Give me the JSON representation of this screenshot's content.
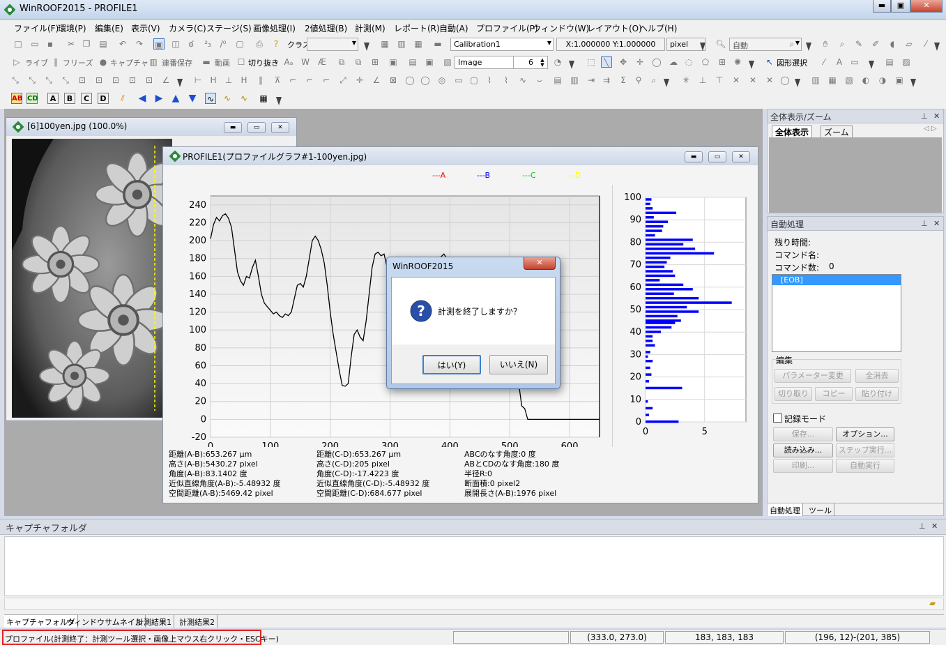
{
  "app": {
    "title": "WinROOF2015 - PROFILE1",
    "brand_color": "#2a8a3a"
  },
  "menu": [
    "ファイル(F)",
    "環境(P)",
    "編集(E)",
    "表示(V)",
    "カメラ(C)",
    "ステージ(S)",
    "画像処理(I)",
    "2値処理(B)",
    "計測(M)",
    "レポート(R)",
    "自動(A)",
    "プロファイル(P)",
    "ウィンドウ(W)",
    "レイアウト(O)",
    "ヘルプ(H)"
  ],
  "toolbar": {
    "class_label": "クラス",
    "calibration": "Calibration1",
    "scale": "X:1.000000  Y:1.000000",
    "unit": "pixel",
    "auto": "自動",
    "live": "ライブ",
    "freeze": "フリーズ",
    "capture": "キャプチャ",
    "seq_save": "連番保存",
    "video": "動画",
    "crop": "切り抜き",
    "image_combo": "Image",
    "spin_value": "6",
    "shape_select": "図形選択"
  },
  "image_window": {
    "title": "[6]100yen.jpg (100.0%)"
  },
  "profile_window": {
    "title": "PROFILE1(プロファイルグラフ#1-100yen.jpg)",
    "legend": [
      {
        "label": "---A",
        "color": "#ff0000"
      },
      {
        "label": "---B",
        "color": "#0000ff"
      },
      {
        "label": "---C",
        "color": "#00cc00"
      },
      {
        "label": "---D",
        "color": "#ffff00"
      }
    ],
    "info": [
      [
        "距離(A-B):653.267 μm",
        "高さ(A-B):5430.27 pixel",
        "角度(A-B):83.1402 度",
        "近似直線角度(A-B):-5.48932 度",
        "空間距離(A-B):5469.42 pixel"
      ],
      [
        "距離(C-D):653.267 μm",
        "高さ(C-D):205 pixel",
        "角度(C-D):-17.4223 度",
        "近似直線角度(C-D):-5.48932 度",
        "空間距離(C-D):684.677 pixel"
      ],
      [
        "ABCのなす角度:0 度",
        "ABとCDのなす角度:180 度",
        "半径R:0",
        "断面積:0 pixel2",
        "展開長さ(A-B):1976 pixel"
      ]
    ]
  },
  "chart_data": [
    {
      "type": "line",
      "x_ticks": [
        0,
        100,
        200,
        300,
        400,
        500,
        600
      ],
      "y_ticks": [
        240,
        220,
        200,
        180,
        160,
        140,
        120,
        100,
        80,
        60,
        40,
        20,
        0,
        -20
      ],
      "xlim": [
        0,
        650
      ],
      "ylim": [
        -20,
        250
      ],
      "grid": true,
      "series": [
        {
          "color": "#000000",
          "x": [
            0,
            5,
            10,
            15,
            20,
            25,
            30,
            35,
            40,
            45,
            50,
            55,
            60,
            65,
            70,
            75,
            80,
            85,
            90,
            95,
            100,
            105,
            110,
            115,
            120,
            125,
            130,
            135,
            140,
            145,
            150,
            155,
            160,
            165,
            170,
            175,
            180,
            185,
            190,
            195,
            200,
            205,
            210,
            215,
            220,
            225,
            230,
            235,
            240,
            245,
            250,
            255,
            260,
            265,
            270,
            275,
            280,
            285,
            290,
            295,
            300,
            305,
            310,
            315,
            320,
            325,
            330,
            335,
            340,
            345,
            350,
            355,
            360,
            365,
            370,
            375,
            380,
            385,
            390,
            395,
            400,
            405,
            410,
            415,
            420,
            425,
            430,
            435,
            440,
            445,
            450,
            455,
            460,
            465,
            470,
            475,
            480,
            485,
            490,
            495,
            500,
            505,
            510,
            515,
            520,
            525,
            530,
            535,
            540,
            545,
            550,
            555,
            560,
            565,
            570,
            575,
            580,
            585,
            590,
            595,
            600,
            605,
            610,
            615,
            620,
            625,
            630,
            635,
            640,
            645,
            650
          ],
          "y": [
            202,
            218,
            226,
            222,
            228,
            230,
            225,
            215,
            190,
            165,
            155,
            150,
            160,
            158,
            170,
            178,
            160,
            140,
            130,
            126,
            122,
            118,
            120,
            116,
            114,
            118,
            116,
            120,
            135,
            150,
            152,
            148,
            160,
            180,
            200,
            205,
            200,
            190,
            175,
            150,
            120,
            95,
            75,
            55,
            38,
            37,
            40,
            70,
            95,
            100,
            92,
            88,
            110,
            140,
            170,
            185,
            187,
            183,
            185,
            170,
            150,
            140,
            130,
            120,
            100,
            85,
            70,
            60,
            45,
            50,
            55,
            70,
            120,
            150,
            160,
            170,
            178,
            182,
            185,
            180,
            175,
            150,
            130,
            90,
            75,
            70,
            80,
            110,
            135,
            128,
            118,
            110,
            90,
            70,
            50,
            45,
            60,
            90,
            120,
            132,
            125,
            100,
            60,
            40,
            15,
            12,
            0,
            0,
            0,
            0,
            0,
            0,
            0,
            0,
            0,
            0,
            0,
            0,
            0,
            0,
            0,
            0,
            0,
            0,
            0,
            0,
            0,
            0,
            0,
            0,
            0
          ]
        }
      ]
    },
    {
      "type": "bar",
      "orientation": "horizontal",
      "x_ticks": [
        0,
        5
      ],
      "y_ticks": [
        100,
        90,
        80,
        70,
        60,
        50,
        40,
        30,
        20,
        10,
        0
      ],
      "xlim": [
        0,
        8.5
      ],
      "ylim": [
        0,
        100
      ],
      "color": "#0000ff",
      "categories": [
        0,
        3,
        6,
        9,
        15,
        18,
        21,
        24,
        27,
        29,
        31,
        34,
        36,
        38,
        40,
        42,
        44,
        45,
        47,
        49,
        51,
        53,
        55,
        57,
        59,
        61,
        63,
        65,
        67,
        69,
        71,
        73,
        75,
        77,
        79,
        81,
        83,
        85,
        87,
        89,
        91,
        93,
        95,
        97,
        99
      ],
      "values": [
        2.8,
        0.3,
        0.6,
        0.2,
        3.1,
        0.3,
        0.5,
        0.4,
        0.6,
        0.2,
        0.4,
        0.8,
        0.6,
        0.6,
        1.3,
        2.2,
        2.5,
        3.0,
        2.7,
        4.5,
        3.5,
        7.3,
        4.5,
        2.4,
        4.0,
        3.2,
        1.2,
        2.5,
        2.3,
        1.6,
        1.8,
        2.1,
        5.8,
        4.2,
        3.2,
        4.0,
        0.8,
        1.4,
        1.5,
        1.9,
        0.7,
        2.6,
        0.6,
        0.4,
        0.5
      ]
    }
  ],
  "dialog": {
    "title": "WinROOF2015",
    "message": "計測を終了しますか？",
    "yes": "はい(Y)",
    "no": "いいえ(N)"
  },
  "right_panel": {
    "overview_title": "全体表示/ズーム",
    "overview_tabs": [
      "全体表示",
      "ズーム"
    ],
    "auto_title": "自動処理",
    "remaining": "残り時間:",
    "command_name": "コマンド名:",
    "command_count_label": "コマンド数:",
    "command_count": "0",
    "list_item": "[EOB]",
    "edit_group": "編集",
    "buttons": [
      "パラメーター変更",
      "全消去",
      "切り取り",
      "コピー",
      "貼り付け"
    ],
    "record_mode": "記録モード",
    "save": "保存...",
    "options": "オプション...",
    "load": "読み込み...",
    "step_run": "ステップ実行...",
    "print": "印刷...",
    "auto_run": "自動実行",
    "bottom_tabs": [
      "自動処理",
      "ツール"
    ]
  },
  "capture_folder": {
    "title": "キャプチャフォルダ",
    "tabs": [
      "キャプチャフォルダ",
      "ウィンドウサムネイル",
      "計測結果1",
      "計測結果2"
    ]
  },
  "status": {
    "hint": "プロファイル(計測終了：計測ツール選択・画像上マウス右クリック・ESCキー)",
    "coords": "(333.0, 273.0)",
    "rgb": "183, 183, 183",
    "range": "(196, 12)-(201, 385)",
    "hint_border": "#e02020"
  }
}
